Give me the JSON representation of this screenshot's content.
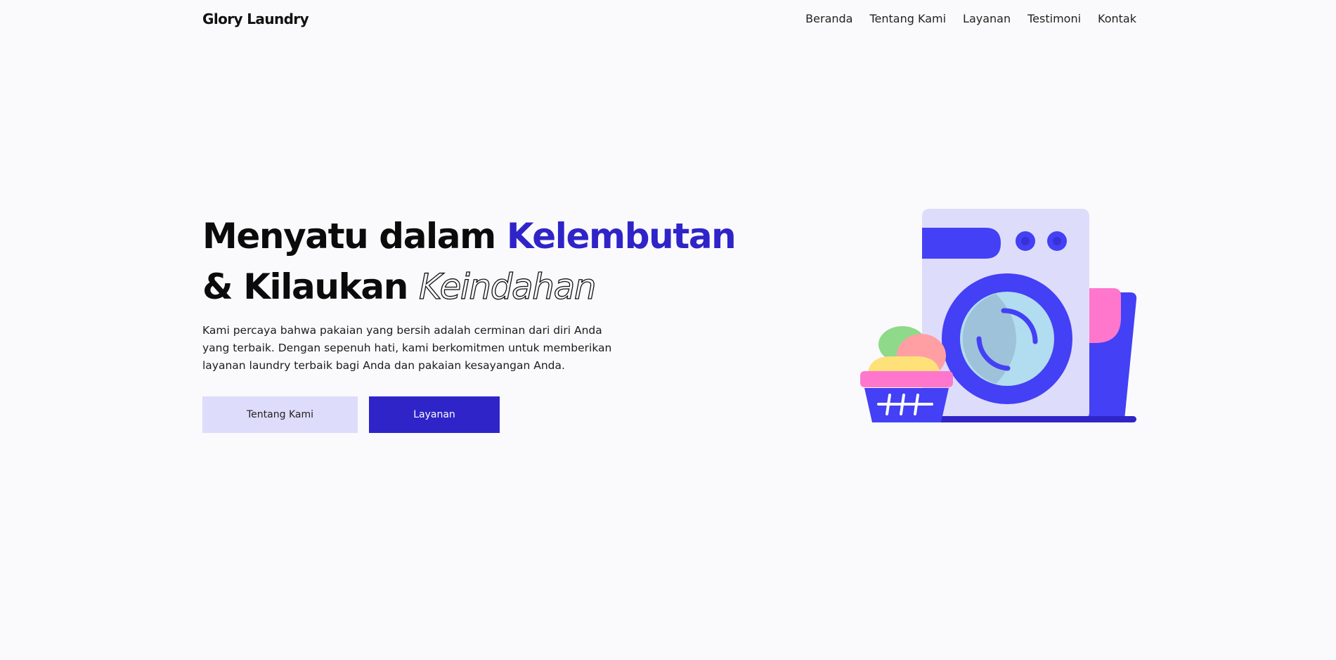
{
  "brand": {
    "name": "Glory Laundry"
  },
  "nav": {
    "items": [
      {
        "label": "Beranda"
      },
      {
        "label": "Tentang Kami"
      },
      {
        "label": "Layanan"
      },
      {
        "label": "Testimoni"
      },
      {
        "label": "Kontak"
      }
    ]
  },
  "hero": {
    "headline_part1": "Menyatu dalam ",
    "headline_accent": "Kelembutan",
    "headline_part2": "& Kilaukan ",
    "headline_outline": "Keindahan",
    "description": "Kami percaya bahwa pakaian yang bersih adalah cerminan dari diri Anda yang terbaik. Dengan sepenuh hati, kami berkomitmen untuk memberikan layanan laundry terbaik bagi Anda dan pakaian kesayangan Anda.",
    "buttons": {
      "secondary_label": "Tentang Kami",
      "primary_label": "Layanan"
    },
    "illustration": {
      "icon": "washing-machine-illustration"
    }
  },
  "colors": {
    "background": "#fafafc",
    "accent": "#2f24c8",
    "button_secondary_bg": "#dedcfb",
    "machine_body": "#dedcfb",
    "machine_blue": "#4340f5",
    "glass": "#b2dcef",
    "pink": "#ff77cc",
    "green": "#8ed98a",
    "peach": "#ff9fa4",
    "yellow": "#ffe17a"
  }
}
